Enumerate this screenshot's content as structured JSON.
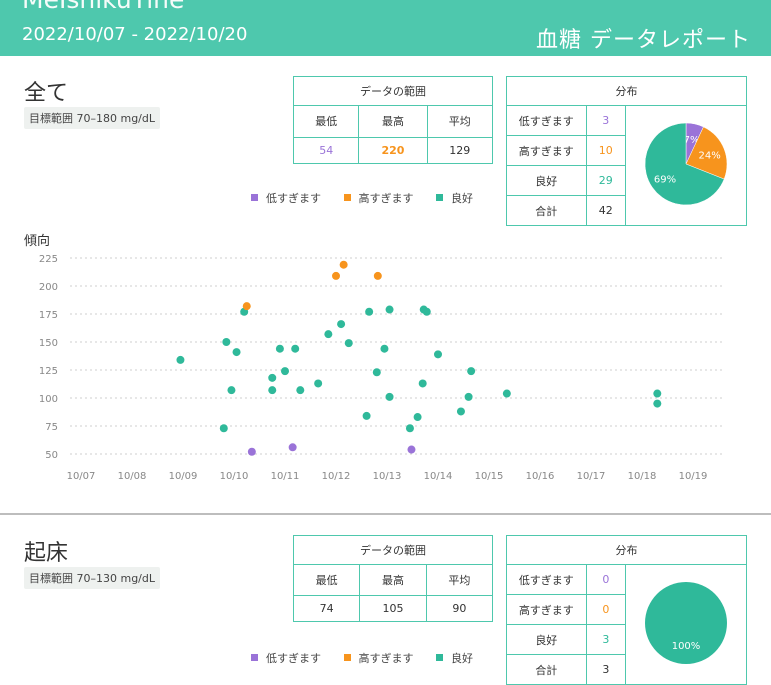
{
  "header": {
    "app_name": "MeIshikuTine",
    "date_range": "2022/10/07 - 2022/10/20",
    "report_title": "血糖 データレポート"
  },
  "labels": {
    "range_header": "データの範囲",
    "min": "最低",
    "max": "最高",
    "avg": "平均",
    "dist_header": "分布",
    "low": "低すぎます",
    "high": "高すぎます",
    "good": "良好",
    "total": "合計",
    "trend": "傾向"
  },
  "colors": {
    "brand": "#4ec8ad",
    "low": "#9a73d8",
    "high": "#f7941d",
    "good": "#2fb99a"
  },
  "sections": [
    {
      "title": "全て",
      "target": "目標範囲 70–180 mg/dL",
      "range": {
        "min": "54",
        "max": "220",
        "avg": "129"
      },
      "dist": {
        "low": "3",
        "high": "10",
        "good": "29",
        "total": "42"
      },
      "pie": {
        "low_pct": 7,
        "high_pct": 24,
        "good_pct": 69
      },
      "pie_labels": {
        "low": "7%",
        "high": "24%",
        "good": "69%"
      }
    },
    {
      "title": "起床",
      "target": "目標範囲 70–130 mg/dL",
      "range": {
        "min": "74",
        "max": "105",
        "avg": "90"
      },
      "dist": {
        "low": "0",
        "high": "0",
        "good": "3",
        "total": "3"
      },
      "pie": {
        "low_pct": 0,
        "high_pct": 0,
        "good_pct": 100
      },
      "pie_labels": {
        "good": "100%"
      }
    }
  ],
  "chart_data": {
    "type": "scatter",
    "title": "傾向",
    "x_ticks": [
      "10/07",
      "10/08",
      "10/09",
      "10/10",
      "10/11",
      "10/12",
      "10/13",
      "10/14",
      "10/15",
      "10/16",
      "10/17",
      "10/18",
      "10/19"
    ],
    "y_ticks": [
      50,
      75,
      100,
      125,
      150,
      175,
      200,
      225
    ],
    "xlim": [
      7,
      19
    ],
    "ylim": [
      50,
      225
    ],
    "points": [
      {
        "x": 8.95,
        "y": 134,
        "c": "good"
      },
      {
        "x": 9.8,
        "y": 73,
        "c": "good"
      },
      {
        "x": 9.85,
        "y": 150,
        "c": "good"
      },
      {
        "x": 9.95,
        "y": 107,
        "c": "good"
      },
      {
        "x": 10.05,
        "y": 141,
        "c": "good"
      },
      {
        "x": 10.2,
        "y": 177,
        "c": "good"
      },
      {
        "x": 10.25,
        "y": 182,
        "c": "high"
      },
      {
        "x": 10.35,
        "y": 52,
        "c": "low"
      },
      {
        "x": 10.75,
        "y": 118,
        "c": "good"
      },
      {
        "x": 10.75,
        "y": 107,
        "c": "good"
      },
      {
        "x": 10.9,
        "y": 144,
        "c": "good"
      },
      {
        "x": 11.0,
        "y": 124,
        "c": "good"
      },
      {
        "x": 11.15,
        "y": 56,
        "c": "low"
      },
      {
        "x": 11.2,
        "y": 144,
        "c": "good"
      },
      {
        "x": 11.3,
        "y": 107,
        "c": "good"
      },
      {
        "x": 11.65,
        "y": 113,
        "c": "good"
      },
      {
        "x": 11.85,
        "y": 157,
        "c": "good"
      },
      {
        "x": 12.0,
        "y": 209,
        "c": "high"
      },
      {
        "x": 12.1,
        "y": 166,
        "c": "good"
      },
      {
        "x": 12.15,
        "y": 219,
        "c": "high"
      },
      {
        "x": 12.25,
        "y": 149,
        "c": "good"
      },
      {
        "x": 12.6,
        "y": 84,
        "c": "good"
      },
      {
        "x": 12.65,
        "y": 177,
        "c": "good"
      },
      {
        "x": 12.8,
        "y": 123,
        "c": "good"
      },
      {
        "x": 12.82,
        "y": 209,
        "c": "high"
      },
      {
        "x": 12.95,
        "y": 144,
        "c": "good"
      },
      {
        "x": 13.05,
        "y": 101,
        "c": "good"
      },
      {
        "x": 13.05,
        "y": 179,
        "c": "good"
      },
      {
        "x": 13.45,
        "y": 73,
        "c": "good"
      },
      {
        "x": 13.48,
        "y": 54,
        "c": "low"
      },
      {
        "x": 13.6,
        "y": 83,
        "c": "good"
      },
      {
        "x": 13.7,
        "y": 113,
        "c": "good"
      },
      {
        "x": 13.72,
        "y": 179,
        "c": "good"
      },
      {
        "x": 13.78,
        "y": 177,
        "c": "good"
      },
      {
        "x": 14.0,
        "y": 139,
        "c": "good"
      },
      {
        "x": 14.45,
        "y": 88,
        "c": "good"
      },
      {
        "x": 14.6,
        "y": 101,
        "c": "good"
      },
      {
        "x": 14.65,
        "y": 124,
        "c": "good"
      },
      {
        "x": 15.35,
        "y": 104,
        "c": "good"
      },
      {
        "x": 18.3,
        "y": 104,
        "c": "good"
      },
      {
        "x": 18.3,
        "y": 95,
        "c": "good"
      }
    ],
    "legend": [
      "低すぎます",
      "高すぎます",
      "良好"
    ]
  }
}
